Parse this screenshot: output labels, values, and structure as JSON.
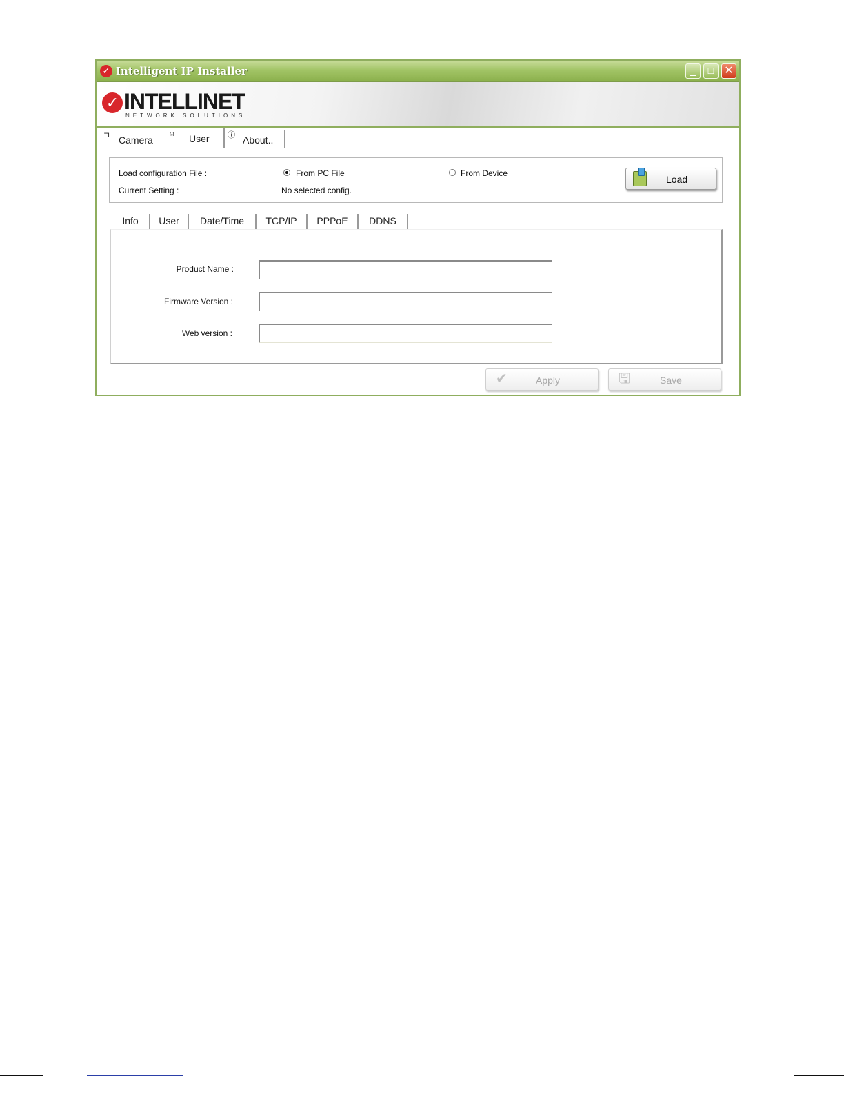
{
  "window": {
    "title": "Intelligent IP Installer",
    "title_icon": "intellinet-check-icon",
    "controls": {
      "minimize": "▁",
      "maximize": "☐",
      "close": "✕"
    }
  },
  "brand": {
    "name": "INTELLINET",
    "tagline": "NETWORK SOLUTIONS",
    "mark": "✓"
  },
  "main_tabs": [
    {
      "label": "Camera",
      "icon": "⊐",
      "icon_name": "camera-icon"
    },
    {
      "label": "User",
      "icon": "⍝",
      "icon_name": "user-icon"
    },
    {
      "label": "About..",
      "icon": "ⓘ",
      "icon_name": "info-icon"
    }
  ],
  "main_tabs_active": "User",
  "config": {
    "load_label": "Load configuration File :",
    "current_label": "Current Setting :",
    "current_value": "No selected config.",
    "options": [
      {
        "label": "From PC File",
        "selected": true
      },
      {
        "label": "From Device",
        "selected": false
      }
    ],
    "load_button": "Load"
  },
  "sub_tabs": [
    "Info",
    "User",
    "Date/Time",
    "TCP/IP",
    "PPPoE",
    "DDNS"
  ],
  "sub_tabs_active": "Info",
  "fields": [
    {
      "label": "Product Name :",
      "value": ""
    },
    {
      "label": "Firmware Version :",
      "value": ""
    },
    {
      "label": "Web version :",
      "value": ""
    }
  ],
  "actions": {
    "apply": "Apply",
    "save": "Save"
  },
  "colors": {
    "titlebar": "#a2c466",
    "frame": "#8fae5e",
    "brand_red": "#d8262b",
    "disabled_text": "#a8a8a8"
  }
}
